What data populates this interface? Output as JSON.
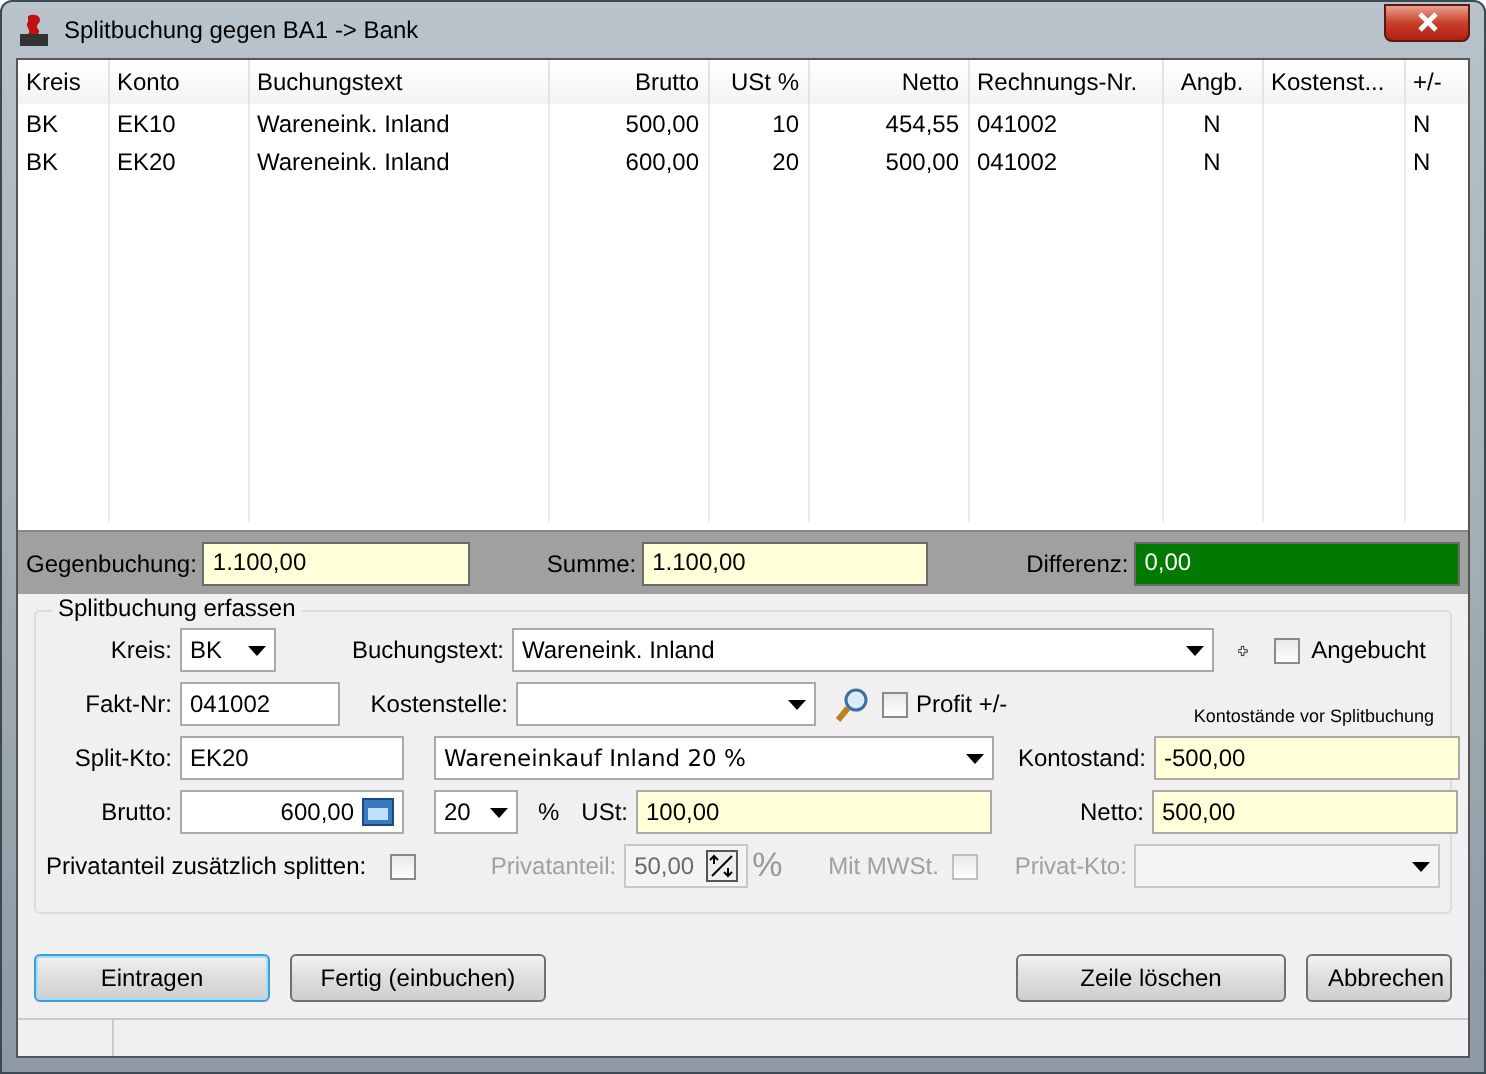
{
  "window": {
    "title": "Splitbuchung gegen BA1 -> Bank"
  },
  "table": {
    "columns": [
      {
        "label": "Kreis",
        "kind": "text"
      },
      {
        "label": "Konto",
        "kind": "text"
      },
      {
        "label": "Buchungstext",
        "kind": "text"
      },
      {
        "label": "Brutto",
        "kind": "amount"
      },
      {
        "label": "USt %",
        "kind": "amount"
      },
      {
        "label": "Netto",
        "kind": "amount"
      },
      {
        "label": "Rechnungs-Nr.",
        "kind": "text"
      },
      {
        "label": "Angb.",
        "kind": "flag"
      },
      {
        "label": "Kostenst...",
        "kind": "text"
      },
      {
        "label": "+/-",
        "kind": "text"
      }
    ],
    "rows": [
      [
        "BK",
        "EK10",
        "Wareneink. Inland",
        "500,00",
        "10",
        "454,55",
        "041002",
        "N",
        "",
        "N"
      ],
      [
        "BK",
        "EK20",
        "Wareneink. Inland",
        "600,00",
        "20",
        "500,00",
        "041002",
        "N",
        "",
        "N"
      ]
    ]
  },
  "totals": {
    "gegenbuchung": {
      "label": "Gegenbuchung:",
      "value": "1.100,00"
    },
    "summe": {
      "label": "Summe:",
      "value": "1.100,00"
    },
    "differenz": {
      "label": "Differenz:",
      "value": "0,00",
      "balanced": true
    }
  },
  "form": {
    "group_title": "Splitbuchung erfassen",
    "kreis": {
      "label": "Kreis:",
      "value": "BK"
    },
    "buchungstext": {
      "label": "Buchungstext:",
      "value": "Wareneink. Inland"
    },
    "angebucht": {
      "label": "Angebucht",
      "checked": false
    },
    "fakt_nr": {
      "label": "Fakt-Nr:",
      "value": "041002"
    },
    "kostenstelle": {
      "label": "Kostenstelle:"
    },
    "profit": {
      "label": "Profit +/-",
      "checked": false
    },
    "kontostand_note": "Kontostände vor Splitbuchung",
    "split_kto": {
      "label": "Split-Kto:",
      "value": "EK20"
    },
    "konto_select": {
      "value": "Wareneinkauf Inland 20 %"
    },
    "kontostand": {
      "label": "Kontostand:",
      "value": "-500,00"
    },
    "brutto": {
      "label": "Brutto:",
      "value": "600,00"
    },
    "ust_rate": {
      "value": "20",
      "unit": "%"
    },
    "ust": {
      "label": "USt:",
      "value": "100,00"
    },
    "netto": {
      "label": "Netto:",
      "value": "500,00"
    },
    "privat_split": {
      "label": "Privatanteil zusätzlich splitten:",
      "checked": false
    },
    "privatanteil": {
      "label": "Privatanteil:",
      "value": "50,00",
      "unit": "%",
      "disabled": true
    },
    "mit_mwst": {
      "label": "Mit MWSt.",
      "checked": false,
      "disabled": true
    },
    "privat_kto": {
      "label": "Privat-Kto:",
      "disabled": true
    }
  },
  "buttons": [
    {
      "label": "Eintragen",
      "default": true
    },
    {
      "label": "Fertig (einbuchen)",
      "default": false
    },
    {
      "label": "Zeile löschen",
      "default": false
    },
    {
      "label": "Abbrechen",
      "default": false
    }
  ]
}
